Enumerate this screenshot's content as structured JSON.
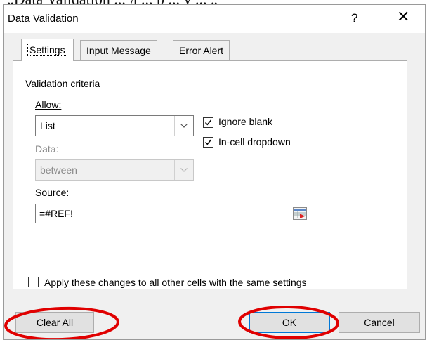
{
  "background_text": "„Data Validation ... д ... р ... у ... „",
  "dialog": {
    "title": "Data Validation",
    "help_label": "?",
    "close_label": "✕"
  },
  "tabs": [
    {
      "label": "Settings",
      "active": true
    },
    {
      "label": "Input Message",
      "active": false
    },
    {
      "label": "Error Alert",
      "active": false
    }
  ],
  "validation": {
    "group_label": "Validation criteria",
    "allow": {
      "label": "Allow:",
      "value": "List"
    },
    "ignore_blank": {
      "label": "Ignore blank",
      "checked": true
    },
    "in_cell_dropdown": {
      "label": "In-cell dropdown",
      "checked": true
    },
    "data": {
      "label": "Data:",
      "value": "between",
      "disabled": true
    },
    "source": {
      "label": "Source:",
      "value": "=#REF!"
    }
  },
  "apply_all": {
    "label": "Apply these changes to all other cells with the same settings",
    "checked": false
  },
  "buttons": {
    "clear_all": "Clear All",
    "ok": "OK",
    "cancel": "Cancel"
  },
  "annotations": {
    "color": "#e00000"
  },
  "icons": {
    "dropdown": "chevron-down-icon",
    "refedit": "collapse-dialog-icon",
    "check": "checkmark-icon"
  }
}
